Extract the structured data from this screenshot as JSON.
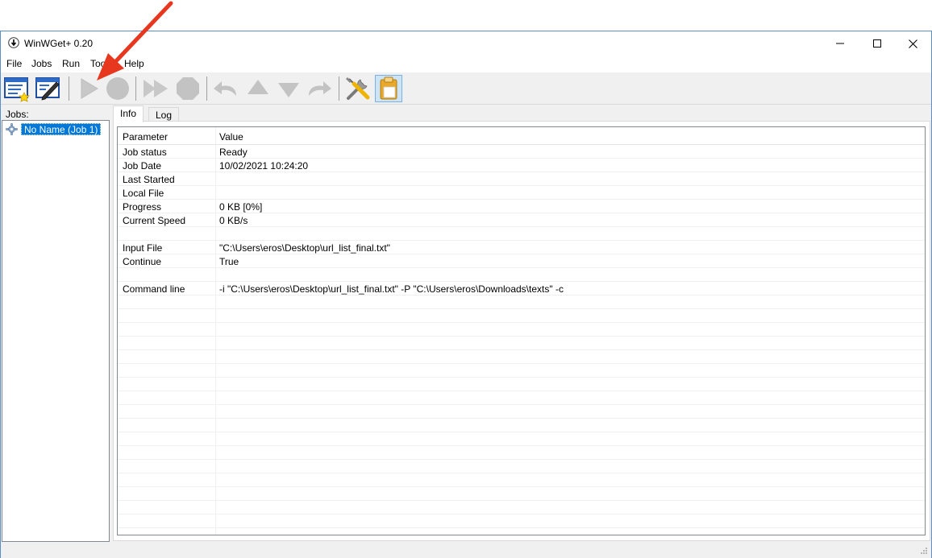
{
  "window": {
    "title": "WinWGet+ 0.20",
    "controls": {
      "minimize": "minimize",
      "maximize": "maximize",
      "close": "close"
    }
  },
  "menu": [
    "File",
    "Jobs",
    "Run",
    "Tools",
    "Help"
  ],
  "toolbar": {
    "icons": [
      "new-job-icon",
      "edit-job-icon",
      "run-icon",
      "stop-icon",
      "run-all-icon",
      "stop-all-icon",
      "move-top-icon",
      "move-up-icon",
      "move-down-icon",
      "move-bottom-icon",
      "settings-icon",
      "clipboard-icon"
    ]
  },
  "jobs": {
    "label": "Jobs:",
    "items": [
      {
        "label": "No Name (Job 1)"
      }
    ]
  },
  "tabs": [
    {
      "label": "Info",
      "selected": true
    },
    {
      "label": "Log",
      "selected": false
    }
  ],
  "info": {
    "headers": {
      "parameter": "Parameter",
      "value": "Value"
    },
    "rows": [
      {
        "parameter": "Job status",
        "value": "Ready"
      },
      {
        "parameter": "Job Date",
        "value": "10/02/2021 10:24:20"
      },
      {
        "parameter": "Last Started",
        "value": ""
      },
      {
        "parameter": "Local File",
        "value": ""
      },
      {
        "parameter": "Progress",
        "value": "0 KB  [0%]"
      },
      {
        "parameter": "Current Speed",
        "value": "0 KB/s"
      },
      {
        "parameter": "",
        "value": ""
      },
      {
        "parameter": "Input File",
        "value": "\"C:\\Users\\eros\\Desktop\\url_list_final.txt\""
      },
      {
        "parameter": "Continue",
        "value": "True"
      },
      {
        "parameter": "",
        "value": ""
      },
      {
        "parameter": "Command line",
        "value": "-i \"C:\\Users\\eros\\Desktop\\url_list_final.txt\" -P \"C:\\Users\\eros\\Downloads\\texts\" -c"
      }
    ]
  },
  "colors": {
    "selection": "#0078d7",
    "annotation_arrow": "#e8371f",
    "window_border": "#5b8dc7"
  }
}
